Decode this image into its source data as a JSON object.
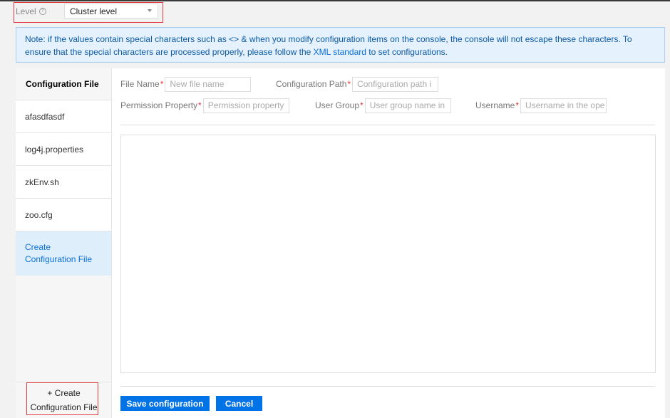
{
  "level": {
    "label": "Level",
    "help_icon": "question-circle-icon",
    "selected": "Cluster level"
  },
  "notice": {
    "text_before": "Note: if the values contain special characters such as <> & when you modify configuration items on the console, the console will not escape these characters. To ensure that the special characters are processed properly, please follow the ",
    "link": "XML standard",
    "text_after": " to set configurations."
  },
  "sidebar": {
    "title": "Configuration File",
    "items": [
      {
        "label": "afasdfasdf"
      },
      {
        "label": "log4j.properties"
      },
      {
        "label": "zkEnv.sh"
      },
      {
        "label": "zoo.cfg"
      },
      {
        "label": "Create Configuration File",
        "line1": "Create",
        "line2": "Configuration File"
      }
    ],
    "bottom_line1": "+ Create",
    "bottom_line2": "Configuration File"
  },
  "form": {
    "file_name": {
      "label": "File Name",
      "placeholder": "New file name"
    },
    "config_path": {
      "label": "Configuration Path",
      "placeholder": "Configuration path i"
    },
    "permission": {
      "label": "Permission Property",
      "placeholder": "Permission property"
    },
    "user_group": {
      "label": "User Group",
      "placeholder": "User group name in"
    },
    "username": {
      "label": "Username",
      "placeholder": "Username in the ope"
    },
    "required_mark": "*"
  },
  "actions": {
    "save": "Save configuration",
    "cancel": "Cancel"
  },
  "colors": {
    "accent": "#0073e6",
    "highlight_box": "#e3383f",
    "notice_bg": "#e5f1fc"
  }
}
